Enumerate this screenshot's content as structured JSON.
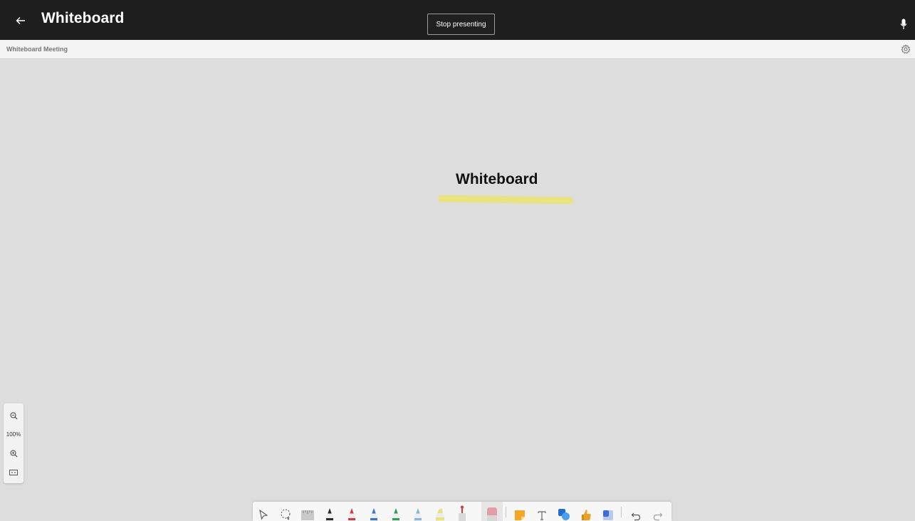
{
  "header": {
    "title": "Whiteboard",
    "stop_presenting_label": "Stop presenting",
    "icons": {
      "back": "arrow-left-icon",
      "mic": "microphone-icon"
    }
  },
  "subheader": {
    "meeting_name": "Whiteboard Meeting",
    "icons": {
      "settings": "gear-icon"
    }
  },
  "canvas": {
    "text": "Whiteboard",
    "highlight_color": "#e8e37e",
    "background": "#dddddd"
  },
  "zoom": {
    "level": "100%",
    "icons": [
      "zoom-out-icon",
      "zoom-in-icon",
      "fit-to-screen-icon"
    ]
  },
  "toolbar": {
    "tools": [
      {
        "name": "select-tool",
        "icon": "pointer-icon"
      },
      {
        "name": "lasso-tool",
        "icon": "lasso-icon"
      },
      {
        "name": "ruler-tool",
        "icon": "ruler-icon"
      },
      {
        "name": "pen-black",
        "icon": "pen-icon",
        "color": "#2a2a2a"
      },
      {
        "name": "pen-red",
        "icon": "pen-icon",
        "color": "#d23a3a"
      },
      {
        "name": "pen-blue",
        "icon": "pen-icon",
        "color": "#2b78d6"
      },
      {
        "name": "pen-green",
        "icon": "pen-icon",
        "color": "#2aa150"
      },
      {
        "name": "pen-lightblue",
        "icon": "pen-icon",
        "color": "#7fb7df"
      },
      {
        "name": "highlighter-yellow",
        "icon": "highlighter-icon",
        "color": "#e8e37e"
      },
      {
        "name": "laser-pointer",
        "icon": "laser-pointer-icon",
        "color": "#d23a3a"
      },
      {
        "name": "eraser",
        "icon": "eraser-icon",
        "color": "#e39ea5"
      },
      {
        "name": "sticky-note",
        "icon": "sticky-note-icon",
        "color": "#f5a623"
      },
      {
        "name": "text-tool",
        "icon": "text-icon"
      },
      {
        "name": "shapes-tool",
        "icon": "shapes-icon",
        "color": "#1f6fd1"
      },
      {
        "name": "reactions-tool",
        "icon": "thumbs-up-icon",
        "color": "#f0a020"
      },
      {
        "name": "templates-tool",
        "icon": "template-icon",
        "color": "#3c6fd8"
      },
      {
        "name": "undo-button",
        "icon": "undo-icon"
      },
      {
        "name": "redo-button",
        "icon": "redo-icon"
      }
    ]
  }
}
